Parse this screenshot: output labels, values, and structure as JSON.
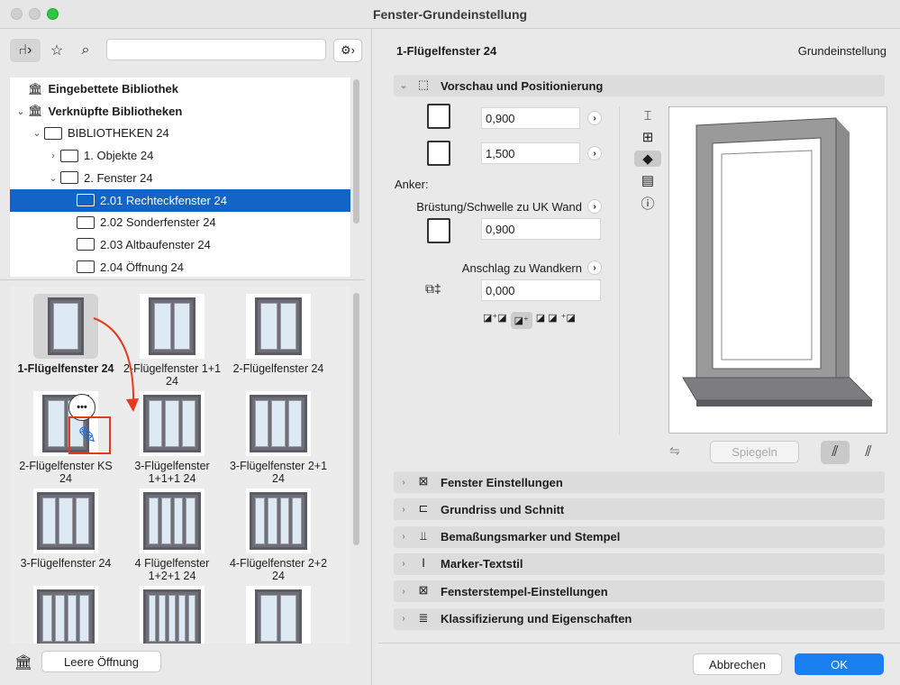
{
  "window": {
    "title": "Fenster-Grundeinstellung"
  },
  "left": {
    "search": {
      "value": "",
      "placeholder": ""
    },
    "tree": [
      {
        "label": "Eingebettete Bibliothek",
        "level": 0,
        "bold": true,
        "chev": ""
      },
      {
        "label": "Verknüpfte Bibliotheken",
        "level": 0,
        "bold": true,
        "chev": "⌄"
      },
      {
        "label": "BIBLIOTHEKEN 24",
        "level": 1,
        "chev": "⌄"
      },
      {
        "label": "1. Objekte 24",
        "level": 2,
        "chev": "›"
      },
      {
        "label": "2. Fenster 24",
        "level": 2,
        "chev": "⌄"
      },
      {
        "label": "2.01 Rechteckfenster 24",
        "level": 3,
        "chev": "",
        "selected": true
      },
      {
        "label": "2.02 Sonderfenster 24",
        "level": 3,
        "chev": ""
      },
      {
        "label": "2.03 Altbaufenster 24",
        "level": 3,
        "chev": ""
      },
      {
        "label": "2.04 Öffnung 24",
        "level": 3,
        "chev": ""
      }
    ],
    "items": [
      {
        "label": "1-Flügelfenster 24",
        "panes": 1,
        "selected": true
      },
      {
        "label": "2-Flügelfenster 1+1 24",
        "panes": 2
      },
      {
        "label": "2-Flügelfenster 24",
        "panes": 2
      },
      {
        "label": "2-Flügelfenster KS 24",
        "panes": 2
      },
      {
        "label": "3-Flügelfenster 1+1+1 24",
        "panes": 3
      },
      {
        "label": "3-Flügelfenster 2+1 24",
        "panes": 3
      },
      {
        "label": "3-Flügelfenster 24",
        "panes": 3
      },
      {
        "label": "4 Flügelfenster 1+2+1 24",
        "panes": 4
      },
      {
        "label": "4-Flügelfenster 2+2 24",
        "panes": 4
      },
      {
        "label": "",
        "panes": 4
      },
      {
        "label": "",
        "panes": 5
      },
      {
        "label": "",
        "panes": 2
      }
    ],
    "more_badge": "•••",
    "empty_opening_button": "Leere Öffnung",
    "accent": "#e8391c"
  },
  "right": {
    "object_name": "1-Flügelfenster 24",
    "mode": "Grundeinstellung",
    "preview_section": "Vorschau und Positionierung",
    "width": "0,900",
    "height": "1,500",
    "anchor_label": "Anker:",
    "sill_label": "Brüstung/Schwelle zu UK Wand",
    "sill_value": "0,900",
    "reveal_label": "Anschlag zu Wandkern",
    "reveal_value": "0,000",
    "mirror_button": "Spiegeln",
    "sections": [
      "Fenster Einstellungen",
      "Grundriss und Schnitt",
      "Bemaßungsmarker und Stempel",
      "Marker-Textstil",
      "Fensterstempel-Einstellungen",
      "Klassifizierung und Eigenschaften"
    ],
    "section_icons": [
      "⊠",
      "⊏",
      "⫫",
      "Ⅰ",
      "⊠",
      "≣"
    ],
    "cancel": "Abbrechen",
    "ok": "OK",
    "ok_color": "#1a7ff0"
  }
}
